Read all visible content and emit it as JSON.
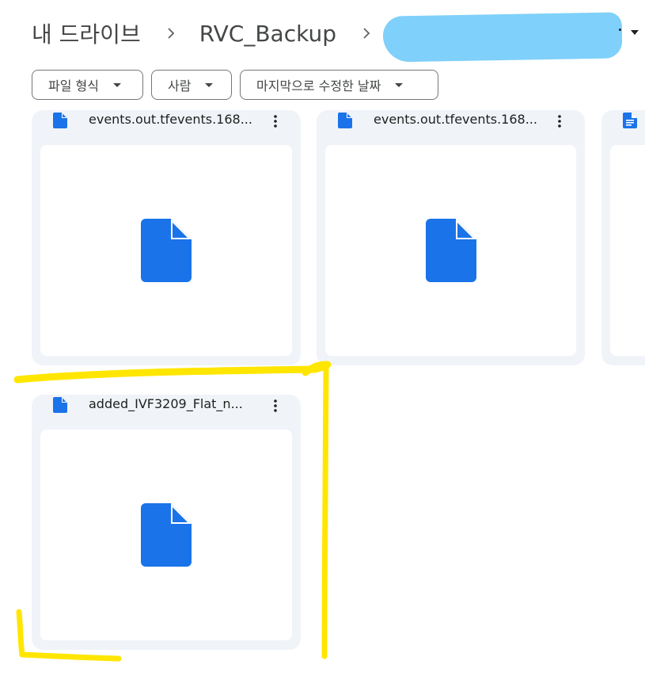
{
  "breadcrumb": {
    "root": "내 드라이브",
    "folder": "RVC_Backup"
  },
  "filters": [
    {
      "label": "파일 형식"
    },
    {
      "label": "사람"
    },
    {
      "label": "마지막으로 수정한 날짜"
    }
  ],
  "files": [
    {
      "name": "events.out.tfevents.168...",
      "icon": "file-icon",
      "type": "generic"
    },
    {
      "name": "events.out.tfevents.168...",
      "icon": "file-icon",
      "type": "generic"
    },
    {
      "name": "",
      "icon": "google-docs-icon",
      "type": "doc"
    },
    {
      "name": "added_IVF3209_Flat_n...",
      "icon": "file-icon",
      "type": "generic"
    }
  ],
  "colors": {
    "accent": "#1a73e8",
    "card_bg": "#f0f4f9",
    "highlight": "#ffe600",
    "redaction": "#7fd0fa"
  }
}
